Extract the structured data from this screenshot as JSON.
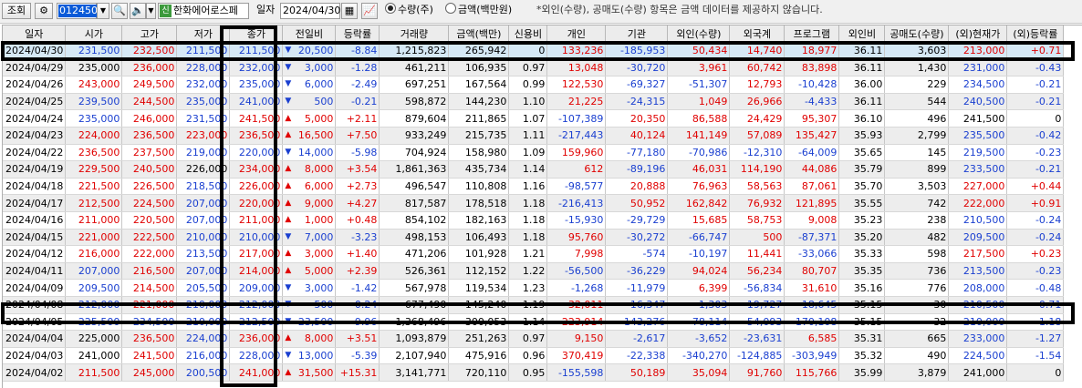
{
  "toolbar": {
    "view_btn": "조회",
    "stock_code": "012450",
    "stock_name_badge": "신",
    "stock_name": "한화에어로스페",
    "date_label": "일자",
    "date_value": "2024/04/30",
    "radio_qty": "수량(주)",
    "radio_amt": "금액(백만원)",
    "notice": "*외인(수량), 공매도(수량) 항목은 금액 데이터를 제공하지 않습니다."
  },
  "grid": {
    "headers": [
      "일자",
      "시가",
      "고가",
      "저가",
      "종가",
      "전일비",
      "등락률",
      "거래량",
      "금액(백만)",
      "신용비",
      "개인",
      "기관",
      "외인(수량)",
      "외국계",
      "프로그램",
      "외인비",
      "공매도(수량)",
      "(외)현재가",
      "(외)등락률"
    ],
    "rows": [
      {
        "c": [
          "2024/04/30",
          "231,500",
          "232,500",
          "211,500",
          "211,500",
          "20,500",
          "-8.84",
          "1,215,823",
          "265,942",
          "0",
          "133,236",
          "-185,953",
          "50,434",
          "14,740",
          "18,977",
          "36.11",
          "3,603",
          "213,000",
          "+0.71"
        ],
        "t": [
          "dn",
          "dn",
          "up",
          "dn",
          "dn",
          "dn",
          "dn",
          "neu",
          "neu",
          "neu",
          "up",
          "dn",
          "up",
          "up",
          "up",
          "neu",
          "neu",
          "up",
          "up"
        ],
        "a": "dn"
      },
      {
        "c": [
          "2024/04/29",
          "235,000",
          "236,000",
          "228,000",
          "232,000",
          "3,000",
          "-1.28",
          "461,211",
          "106,935",
          "0.97",
          "13,048",
          "-30,720",
          "3,961",
          "60,742",
          "83,898",
          "36.11",
          "1,430",
          "231,000",
          "-0.43"
        ],
        "t": [
          "neu",
          "neu",
          "up",
          "dn",
          "dn",
          "dn",
          "dn",
          "neu",
          "neu",
          "neu",
          "up",
          "dn",
          "up",
          "up",
          "up",
          "neu",
          "neu",
          "dn",
          "dn"
        ],
        "a": "dn"
      },
      {
        "c": [
          "2024/04/26",
          "243,000",
          "249,500",
          "232,000",
          "235,000",
          "6,000",
          "-2.49",
          "697,251",
          "167,564",
          "0.99",
          "122,530",
          "-69,327",
          "-51,307",
          "12,793",
          "-10,428",
          "36.00",
          "229",
          "234,500",
          "-0.21"
        ],
        "t": [
          "neu",
          "up",
          "up",
          "dn",
          "dn",
          "dn",
          "dn",
          "neu",
          "neu",
          "neu",
          "up",
          "dn",
          "dn",
          "up",
          "dn",
          "neu",
          "neu",
          "dn",
          "dn"
        ],
        "a": "dn"
      },
      {
        "c": [
          "2024/04/25",
          "239,500",
          "244,500",
          "235,000",
          "241,000",
          "500",
          "-0.21",
          "598,872",
          "144,230",
          "1.10",
          "21,225",
          "-24,315",
          "1,049",
          "26,966",
          "-4,433",
          "36.11",
          "544",
          "240,500",
          "-0.21"
        ],
        "t": [
          "neu",
          "dn",
          "up",
          "dn",
          "dn",
          "dn",
          "dn",
          "neu",
          "neu",
          "neu",
          "up",
          "dn",
          "up",
          "up",
          "dn",
          "neu",
          "neu",
          "dn",
          "dn"
        ],
        "a": "dn"
      },
      {
        "c": [
          "2024/04/24",
          "235,000",
          "246,000",
          "231,500",
          "241,500",
          "5,000",
          "+2.11",
          "879,604",
          "211,865",
          "1.07",
          "-107,389",
          "20,350",
          "86,588",
          "24,429",
          "95,307",
          "36.10",
          "496",
          "241,500",
          "0"
        ],
        "t": [
          "neu",
          "dn",
          "up",
          "dn",
          "up",
          "up",
          "up",
          "neu",
          "neu",
          "neu",
          "dn",
          "up",
          "up",
          "up",
          "up",
          "neu",
          "neu",
          "neu",
          "neu"
        ],
        "a": "up"
      },
      {
        "c": [
          "2024/04/23",
          "224,000",
          "236,500",
          "223,000",
          "236,500",
          "16,500",
          "+7.50",
          "933,249",
          "215,735",
          "1.11",
          "-217,443",
          "40,124",
          "141,149",
          "57,089",
          "135,427",
          "35.93",
          "2,799",
          "235,500",
          "-0.42"
        ],
        "t": [
          "neu",
          "up",
          "up",
          "up",
          "up",
          "up",
          "up",
          "neu",
          "neu",
          "neu",
          "dn",
          "up",
          "up",
          "up",
          "up",
          "neu",
          "neu",
          "dn",
          "dn"
        ],
        "a": "up"
      },
      {
        "c": [
          "2024/04/22",
          "236,500",
          "237,500",
          "219,000",
          "220,000",
          "14,000",
          "-5.98",
          "704,924",
          "158,980",
          "1.09",
          "159,960",
          "-77,180",
          "-70,986",
          "-12,310",
          "-64,009",
          "35.65",
          "145",
          "219,500",
          "-0.23"
        ],
        "t": [
          "neu",
          "up",
          "up",
          "dn",
          "dn",
          "dn",
          "dn",
          "neu",
          "neu",
          "neu",
          "up",
          "dn",
          "dn",
          "dn",
          "dn",
          "neu",
          "neu",
          "dn",
          "dn"
        ],
        "a": "dn"
      },
      {
        "c": [
          "2024/04/19",
          "229,500",
          "240,500",
          "226,000",
          "234,000",
          "8,000",
          "+3.54",
          "1,861,363",
          "435,734",
          "1.14",
          "612",
          "-89,196",
          "46,031",
          "114,190",
          "44,086",
          "35.79",
          "899",
          "233,500",
          "-0.21"
        ],
        "t": [
          "neu",
          "up",
          "up",
          "neu",
          "up",
          "up",
          "up",
          "neu",
          "neu",
          "neu",
          "up",
          "dn",
          "up",
          "up",
          "up",
          "neu",
          "neu",
          "dn",
          "dn"
        ],
        "a": "up"
      },
      {
        "c": [
          "2024/04/18",
          "221,500",
          "226,500",
          "218,500",
          "226,000",
          "6,000",
          "+2.73",
          "496,547",
          "110,808",
          "1.16",
          "-98,577",
          "20,888",
          "76,963",
          "58,563",
          "87,061",
          "35.70",
          "3,503",
          "227,000",
          "+0.44"
        ],
        "t": [
          "neu",
          "up",
          "up",
          "dn",
          "up",
          "up",
          "up",
          "neu",
          "neu",
          "neu",
          "dn",
          "up",
          "up",
          "up",
          "up",
          "neu",
          "neu",
          "up",
          "up"
        ],
        "a": "up"
      },
      {
        "c": [
          "2024/04/17",
          "212,500",
          "224,500",
          "207,000",
          "220,000",
          "9,000",
          "+4.27",
          "817,587",
          "178,518",
          "1.18",
          "-216,413",
          "50,952",
          "162,842",
          "76,932",
          "121,895",
          "35.55",
          "742",
          "222,000",
          "+0.91"
        ],
        "t": [
          "neu",
          "up",
          "up",
          "dn",
          "up",
          "up",
          "up",
          "neu",
          "neu",
          "neu",
          "dn",
          "up",
          "up",
          "up",
          "up",
          "neu",
          "neu",
          "up",
          "up"
        ],
        "a": "up"
      },
      {
        "c": [
          "2024/04/16",
          "211,000",
          "220,500",
          "207,000",
          "211,000",
          "1,000",
          "+0.48",
          "854,102",
          "182,163",
          "1.18",
          "-15,930",
          "-29,729",
          "15,685",
          "58,753",
          "9,008",
          "35.23",
          "238",
          "210,500",
          "-0.24"
        ],
        "t": [
          "neu",
          "up",
          "up",
          "dn",
          "up",
          "up",
          "up",
          "neu",
          "neu",
          "neu",
          "dn",
          "dn",
          "up",
          "up",
          "up",
          "neu",
          "neu",
          "dn",
          "dn"
        ],
        "a": "up"
      },
      {
        "c": [
          "2024/04/15",
          "221,000",
          "222,500",
          "210,000",
          "210,000",
          "7,000",
          "-3.23",
          "498,153",
          "106,493",
          "1.18",
          "95,760",
          "-30,272",
          "-66,747",
          "500",
          "-87,371",
          "35.20",
          "482",
          "209,500",
          "-0.24"
        ],
        "t": [
          "neu",
          "up",
          "up",
          "dn",
          "dn",
          "dn",
          "dn",
          "neu",
          "neu",
          "neu",
          "up",
          "dn",
          "dn",
          "up",
          "dn",
          "neu",
          "neu",
          "dn",
          "dn"
        ],
        "a": "dn"
      },
      {
        "c": [
          "2024/04/12",
          "216,000",
          "222,000",
          "213,500",
          "217,000",
          "3,000",
          "+1.40",
          "471,206",
          "101,928",
          "1.21",
          "7,998",
          "-574",
          "-10,197",
          "11,441",
          "-33,066",
          "35.33",
          "598",
          "217,500",
          "+0.23"
        ],
        "t": [
          "neu",
          "up",
          "up",
          "dn",
          "up",
          "up",
          "up",
          "neu",
          "neu",
          "neu",
          "up",
          "dn",
          "dn",
          "up",
          "dn",
          "neu",
          "neu",
          "up",
          "up"
        ],
        "a": "up"
      },
      {
        "c": [
          "2024/04/11",
          "207,000",
          "216,500",
          "207,000",
          "214,000",
          "5,000",
          "+2.39",
          "526,361",
          "112,152",
          "1.22",
          "-56,500",
          "-36,229",
          "94,024",
          "56,234",
          "80,707",
          "35.35",
          "736",
          "213,500",
          "-0.23"
        ],
        "t": [
          "neu",
          "dn",
          "up",
          "dn",
          "up",
          "up",
          "up",
          "neu",
          "neu",
          "neu",
          "dn",
          "dn",
          "up",
          "up",
          "up",
          "neu",
          "neu",
          "dn",
          "dn"
        ],
        "a": "up"
      },
      {
        "c": [
          "2024/04/09",
          "209,500",
          "214,500",
          "205,500",
          "209,000",
          "3,000",
          "-1.42",
          "567,978",
          "119,534",
          "1.23",
          "-1,268",
          "-11,979",
          "6,399",
          "-56,834",
          "31,610",
          "35.16",
          "776",
          "208,000",
          "-0.48"
        ],
        "t": [
          "neu",
          "dn",
          "up",
          "dn",
          "dn",
          "dn",
          "dn",
          "neu",
          "neu",
          "neu",
          "dn",
          "dn",
          "up",
          "dn",
          "up",
          "neu",
          "neu",
          "dn",
          "dn"
        ],
        "a": "dn"
      },
      {
        "c": [
          "2024/04/08",
          "212,000",
          "221,000",
          "210,000",
          "212,000",
          "500",
          "-0.24",
          "677,490",
          "145,240",
          "1.19",
          "32,011",
          "-16,347",
          "-1,303",
          "-19,727",
          "-18,645",
          "35.15",
          "30",
          "210,500",
          "-0.71"
        ],
        "t": [
          "neu",
          "dn",
          "up",
          "dn",
          "dn",
          "dn",
          "dn",
          "neu",
          "neu",
          "neu",
          "up",
          "dn",
          "dn",
          "dn",
          "dn",
          "neu",
          "neu",
          "dn",
          "dn"
        ],
        "a": "dn"
      },
      {
        "c": [
          "2024/04/05",
          "225,500",
          "234,500",
          "210,000",
          "212,500",
          "23,500",
          "-9.96",
          "1,368,496",
          "300,053",
          "1.14",
          "223,914",
          "-143,276",
          "-78,114",
          "-54,093",
          "-170,108",
          "35.15",
          "32",
          "210,000",
          "-1.18"
        ],
        "t": [
          "neu",
          "dn",
          "dn",
          "dn",
          "dn",
          "dn",
          "dn",
          "neu",
          "neu",
          "neu",
          "up",
          "dn",
          "dn",
          "dn",
          "dn",
          "neu",
          "neu",
          "dn",
          "dn"
        ],
        "a": "dn"
      },
      {
        "c": [
          "2024/04/04",
          "225,000",
          "236,500",
          "224,000",
          "236,000",
          "8,000",
          "+3.51",
          "1,093,879",
          "251,263",
          "0.97",
          "9,150",
          "-2,617",
          "-3,652",
          "-23,631",
          "6,585",
          "35.31",
          "665",
          "233,000",
          "-1.27"
        ],
        "t": [
          "neu",
          "neu",
          "up",
          "dn",
          "up",
          "up",
          "up",
          "neu",
          "neu",
          "neu",
          "up",
          "dn",
          "dn",
          "dn",
          "up",
          "neu",
          "neu",
          "dn",
          "dn"
        ],
        "a": "up"
      },
      {
        "c": [
          "2024/04/03",
          "241,000",
          "241,500",
          "216,000",
          "228,000",
          "13,000",
          "-5.39",
          "2,107,940",
          "475,916",
          "0.96",
          "370,419",
          "-22,338",
          "-340,270",
          "-124,885",
          "-303,949",
          "35.32",
          "490",
          "224,500",
          "-1.54"
        ],
        "t": [
          "neu",
          "neu",
          "up",
          "dn",
          "dn",
          "dn",
          "dn",
          "neu",
          "neu",
          "neu",
          "up",
          "dn",
          "dn",
          "dn",
          "dn",
          "neu",
          "neu",
          "dn",
          "dn"
        ],
        "a": "dn"
      },
      {
        "c": [
          "2024/04/02",
          "211,500",
          "245,000",
          "200,500",
          "241,000",
          "31,500",
          "+15.31",
          "3,141,771",
          "720,110",
          "0.95",
          "-155,598",
          "50,189",
          "35,094",
          "91,760",
          "115,766",
          "35.99",
          "3,879",
          "241,000",
          "0"
        ],
        "t": [
          "neu",
          "up",
          "up",
          "dn",
          "up",
          "up",
          "up",
          "neu",
          "neu",
          "neu",
          "dn",
          "up",
          "up",
          "up",
          "up",
          "neu",
          "neu",
          "neu",
          "neu"
        ],
        "a": "up"
      }
    ]
  },
  "colors": {
    "up": "#e00000",
    "down": "#1a3fd0",
    "selected_row": "#d6e9f6",
    "alt_row": "#ededed"
  }
}
